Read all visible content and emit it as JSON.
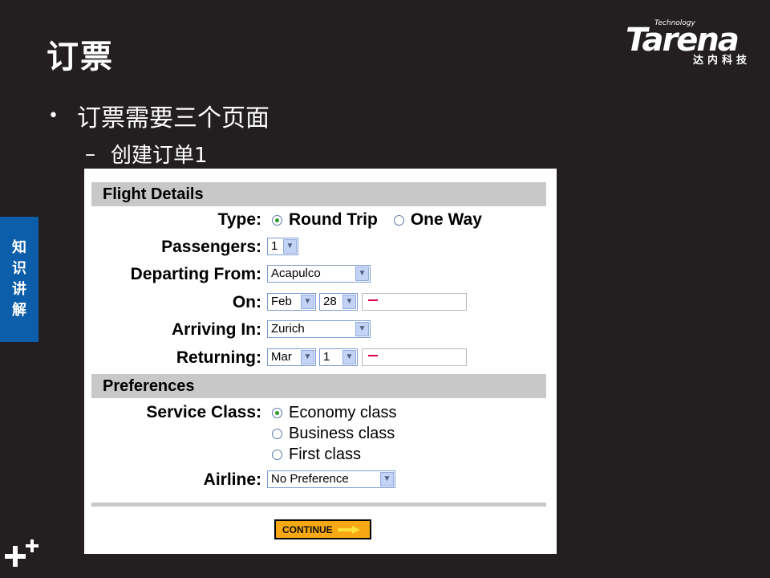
{
  "slide": {
    "title": "订票",
    "bullet": "订票需要三个页面",
    "sub_bullet": "创建订单1",
    "side_tab": [
      "知",
      "识",
      "讲",
      "解"
    ]
  },
  "logo": {
    "small": "Technology",
    "name": "Tarena",
    "cn": "达内科技"
  },
  "form": {
    "flight_section": "Flight Details",
    "type_label": "Type:",
    "type_options": [
      "Round Trip",
      "One Way"
    ],
    "type_selected": "Round Trip",
    "passengers_label": "Passengers:",
    "passengers_value": "1",
    "departing_label": "Departing From:",
    "departing_value": "Acapulco",
    "on_label": "On:",
    "on_month": "Feb",
    "on_day": "28",
    "arriving_label": "Arriving In:",
    "arriving_value": "Zurich",
    "returning_label": "Returning:",
    "returning_month": "Mar",
    "returning_day": "1",
    "preferences_section": "Preferences",
    "service_class_label": "Service Class:",
    "service_classes": [
      "Economy class",
      "Business class",
      "First class"
    ],
    "service_selected": "Economy class",
    "airline_label": "Airline:",
    "airline_value": "No Preference",
    "continue_label": "CONTINUE"
  },
  "colors": {
    "background": "#231f20",
    "side_tab": "#0c5daa",
    "section_bar": "#c8c8c8",
    "continue_button": "#f7a812"
  }
}
